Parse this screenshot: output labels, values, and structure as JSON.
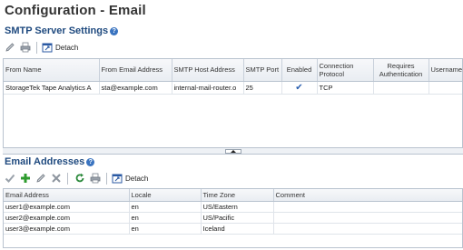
{
  "page": {
    "title": "Configuration - Email"
  },
  "smtp": {
    "title": "SMTP Server Settings",
    "toolbar": {
      "detach_label": "Detach"
    },
    "columns": [
      "From Name",
      "From Email Address",
      "SMTP Host Address",
      "SMTP Port",
      "Enabled",
      "Connection Protocol",
      "Requires Authentication",
      "Username"
    ],
    "rows": [
      {
        "from_name": "StorageTek Tape Analytics A",
        "from_email": "sta@example.com",
        "host": "internal-mail-router.o",
        "port": "25",
        "enabled": true,
        "protocol": "TCP",
        "auth": "",
        "username": ""
      }
    ]
  },
  "email": {
    "title": "Email Addresses",
    "toolbar": {
      "detach_label": "Detach"
    },
    "columns": [
      "Email Address",
      "Locale",
      "Time Zone",
      "Comment"
    ],
    "rows": [
      {
        "address": "user1@example.com",
        "locale": "en",
        "tz": "US/Eastern",
        "comment": ""
      },
      {
        "address": "user2@example.com",
        "locale": "en",
        "tz": "US/Pacific",
        "comment": ""
      },
      {
        "address": "user3@example.com",
        "locale": "en",
        "tz": "Iceland",
        "comment": ""
      }
    ]
  },
  "icons": {
    "edit": "pencil-icon",
    "print": "printer-icon",
    "detach": "detach-icon",
    "check": "checkmark-icon",
    "add": "plus-icon",
    "delete": "x-icon",
    "refresh": "refresh-icon",
    "help": "help-icon"
  },
  "colors": {
    "section_title": "#1f4a7f",
    "accent": "#3a74c0",
    "add_green": "#2e9b2e",
    "refresh_green": "#2c8a3c"
  }
}
